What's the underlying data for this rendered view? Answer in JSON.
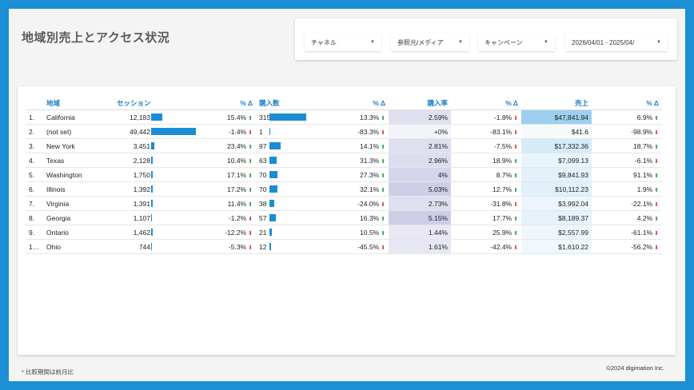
{
  "title": "地域別売上とアクセス状況",
  "filters": [
    {
      "label": "チャネル"
    },
    {
      "label": "参照元/メディア"
    },
    {
      "label": "キャンペーン"
    },
    {
      "label": "2026/04/01 - 2025/04/"
    }
  ],
  "table": {
    "headers": [
      "地域",
      "セッション",
      "% Δ",
      "購入数",
      "% Δ",
      "購入率",
      "% Δ",
      "売上",
      "% Δ"
    ],
    "rows": [
      {
        "idx": "1.",
        "region": "California",
        "sessions": "12,183",
        "sessions_value": 12183,
        "sess_d": "15.4%",
        "sess_dir": "up",
        "purch": "315",
        "purch_value": 315,
        "purch_d": "13.3%",
        "purch_dir": "up",
        "rate": "2.59%",
        "rate_d": "-1.8%",
        "rate_dir": "down",
        "rev": "$47,841.94",
        "rev_d": "6.9%",
        "rev_dir": "up"
      },
      {
        "idx": "2.",
        "region": "(not set)",
        "sessions": "49,442",
        "sessions_value": 49442,
        "sess_d": "-1.4%",
        "sess_dir": "down",
        "purch": "1",
        "purch_value": 1,
        "purch_d": "-83.3%",
        "purch_dir": "down",
        "rate": "+0%",
        "rate_d": "-83.1%",
        "rate_dir": "down",
        "rev": "$41.6",
        "rev_d": "-98.9%",
        "rev_dir": "down"
      },
      {
        "idx": "3.",
        "region": "New York",
        "sessions": "3,451",
        "sessions_value": 3451,
        "sess_d": "23.4%",
        "sess_dir": "up",
        "purch": "97",
        "purch_value": 97,
        "purch_d": "14.1%",
        "purch_dir": "up",
        "rate": "2.81%",
        "rate_d": "-7.5%",
        "rate_dir": "down",
        "rev": "$17,332.36",
        "rev_d": "18.7%",
        "rev_dir": "up"
      },
      {
        "idx": "4.",
        "region": "Texas",
        "sessions": "2,128",
        "sessions_value": 2128,
        "sess_d": "10.4%",
        "sess_dir": "up",
        "purch": "63",
        "purch_value": 63,
        "purch_d": "31.3%",
        "purch_dir": "up",
        "rate": "2.96%",
        "rate_d": "18.9%",
        "rate_dir": "up",
        "rev": "$7,099.13",
        "rev_d": "-6.1%",
        "rev_dir": "down"
      },
      {
        "idx": "5.",
        "region": "Washington",
        "sessions": "1,750",
        "sessions_value": 1750,
        "sess_d": "17.1%",
        "sess_dir": "up",
        "purch": "70",
        "purch_value": 70,
        "purch_d": "27.3%",
        "purch_dir": "up",
        "rate": "4%",
        "rate_d": "8.7%",
        "rate_dir": "up",
        "rev": "$9,841.93",
        "rev_d": "91.1%",
        "rev_dir": "up"
      },
      {
        "idx": "6.",
        "region": "Illinois",
        "sessions": "1,392",
        "sessions_value": 1392,
        "sess_d": "17.2%",
        "sess_dir": "up",
        "purch": "70",
        "purch_value": 70,
        "purch_d": "32.1%",
        "purch_dir": "up",
        "rate": "5.03%",
        "rate_d": "12.7%",
        "rate_dir": "up",
        "rev": "$10,112.23",
        "rev_d": "1.9%",
        "rev_dir": "up"
      },
      {
        "idx": "7.",
        "region": "Virginia",
        "sessions": "1,391",
        "sessions_value": 1391,
        "sess_d": "11.4%",
        "sess_dir": "up",
        "purch": "38",
        "purch_value": 38,
        "purch_d": "-24.0%",
        "purch_dir": "down",
        "rate": "2.73%",
        "rate_d": "-31.8%",
        "rate_dir": "down",
        "rev": "$3,992.04",
        "rev_d": "-22.1%",
        "rev_dir": "down"
      },
      {
        "idx": "8.",
        "region": "Georgia",
        "sessions": "1,107",
        "sessions_value": 1107,
        "sess_d": "-1.2%",
        "sess_dir": "down",
        "purch": "57",
        "purch_value": 57,
        "purch_d": "16.3%",
        "purch_dir": "up",
        "rate": "5.15%",
        "rate_d": "17.7%",
        "rate_dir": "up",
        "rev": "$8,189.37",
        "rev_d": "4.2%",
        "rev_dir": "up"
      },
      {
        "idx": "9.",
        "region": "Ontario",
        "sessions": "1,462",
        "sessions_value": 1462,
        "sess_d": "-12.2%",
        "sess_dir": "down",
        "purch": "21",
        "purch_value": 21,
        "purch_d": "10.5%",
        "purch_dir": "up",
        "rate": "1.44%",
        "rate_d": "25.9%",
        "rate_dir": "up",
        "rev": "$2,557.99",
        "rev_d": "-61.1%",
        "rev_dir": "down"
      },
      {
        "idx": "1…",
        "region": "Ohio",
        "sessions": "744",
        "sessions_value": 744,
        "sess_d": "-5.3%",
        "sess_dir": "down",
        "purch": "12",
        "purch_value": 12,
        "purch_d": "-45.5%",
        "purch_dir": "down",
        "rate": "1.61%",
        "rate_d": "-42.4%",
        "rate_dir": "down",
        "rev": "$1,610.22",
        "rev_d": "-56.2%",
        "rev_dir": "down"
      }
    ]
  },
  "footnote": "* 比較期間は前月比",
  "copyright": "©2024 digimation Inc.",
  "colors": {
    "accent": "#1c8fd6",
    "bar": "#1b8dd4",
    "up": "#2e9e3e",
    "down": "#d23b30",
    "rate_heat": "#cfd0ea",
    "rev_heat": "#92cdee"
  }
}
